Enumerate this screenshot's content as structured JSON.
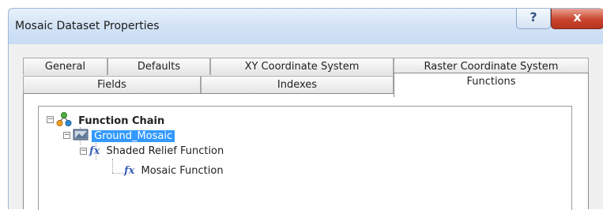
{
  "window": {
    "title": "Mosaic Dataset Properties",
    "help_glyph": "?",
    "close_glyph": "x"
  },
  "tabs": {
    "row_back": [
      {
        "label": "General"
      },
      {
        "label": "Defaults"
      },
      {
        "label": "XY Coordinate System"
      },
      {
        "label": "Raster Coordinate System"
      }
    ],
    "row_front": [
      {
        "label": "Fields"
      },
      {
        "label": "Indexes"
      },
      {
        "label": "Functions",
        "active": true
      }
    ]
  },
  "tree": {
    "root": {
      "label": "Function Chain",
      "icon": "function-chain-icon",
      "expander": "−"
    },
    "dataset": {
      "label": "Ground_Mosaic",
      "icon": "raster-dataset-icon",
      "expander": "−",
      "selected": true
    },
    "functions": [
      {
        "label": "Shaded Relief Function",
        "icon": "fx-icon",
        "glyph": "fx",
        "expander": "−"
      },
      {
        "label": "Mosaic Function",
        "icon": "fx-icon",
        "glyph": "fx"
      }
    ]
  },
  "colors": {
    "selection": "#3399ff",
    "close_button": "#c9452d",
    "titlebar": "#d4e4f6"
  }
}
